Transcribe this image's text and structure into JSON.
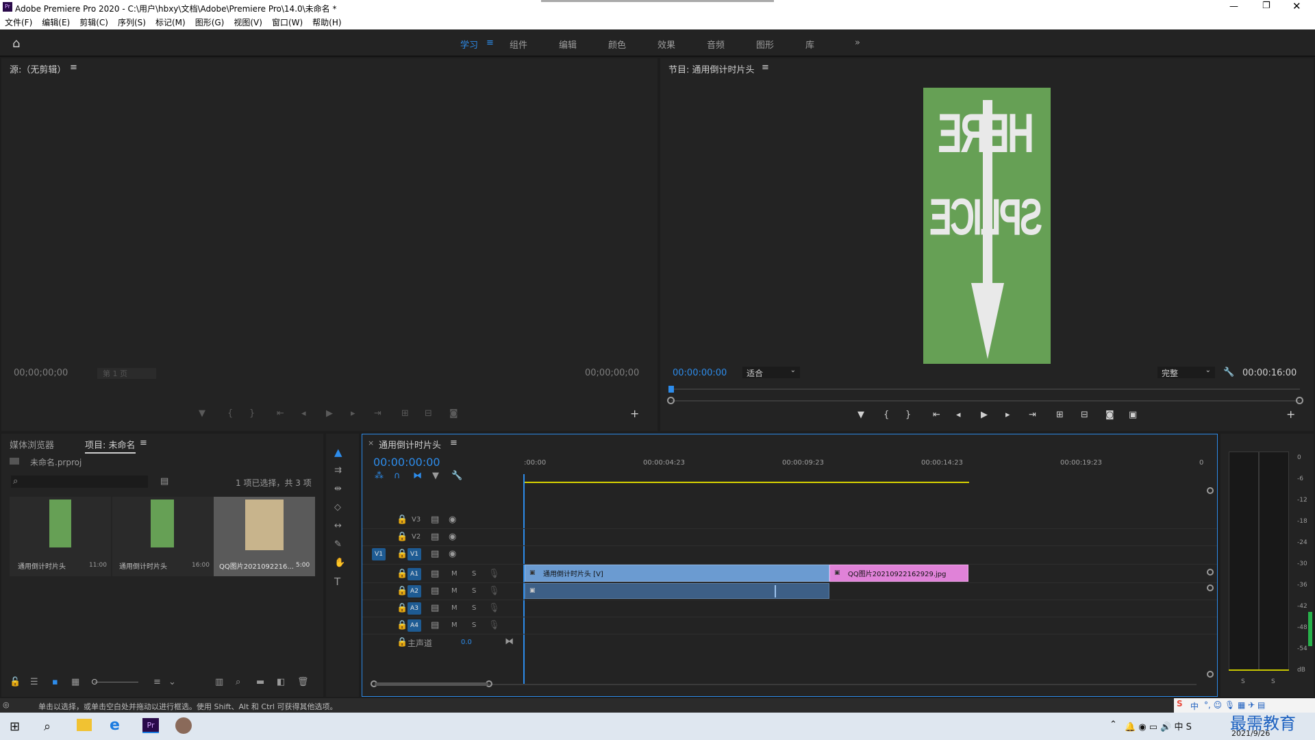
{
  "app": {
    "title": "Adobe Premiere Pro 2020 - C:\\用户\\hbxy\\文档\\Adobe\\Premiere Pro\\14.0\\未命名 *",
    "icon": "Pr"
  },
  "menu": [
    "文件(F)",
    "编辑(E)",
    "剪辑(C)",
    "序列(S)",
    "标记(M)",
    "图形(G)",
    "视图(V)",
    "窗口(W)",
    "帮助(H)"
  ],
  "workspaces": {
    "items": [
      "学习",
      "组件",
      "编辑",
      "颜色",
      "效果",
      "音频",
      "图形",
      "库"
    ],
    "active": "学习"
  },
  "source": {
    "title": "源:（无剪辑）",
    "tc_left": "00;00;00;00",
    "tc_right": "00;00;00;00",
    "page": "第 1 页"
  },
  "program": {
    "title": "节目: 通用倒计时片头",
    "tc_current": "00:00:00:00",
    "fit": "适合",
    "quality": "完整",
    "duration": "00:00:16:00",
    "preview_text_1": "HERE",
    "preview_text_2": "SPLICE",
    "preview_bg": "#66a055"
  },
  "project": {
    "tab_media": "媒体浏览器",
    "tab_project": "项目: 未命名",
    "file": "未命名.prproj",
    "selection": "1 项已选择，共 3 项",
    "items": [
      {
        "name": "通用倒计时片头",
        "dur": "11:00"
      },
      {
        "name": "通用倒计时片头",
        "dur": "16:00"
      },
      {
        "name": "QQ图片2021092216...",
        "dur": "5:00"
      }
    ]
  },
  "timeline": {
    "tab": "通用倒计时片头",
    "tc": "00:00:00:00",
    "ticks": [
      ":00:00",
      "00:00:04:23",
      "00:00:09:23",
      "00:00:14:23",
      "00:00:19:23",
      "0"
    ],
    "video_tracks": [
      "V3",
      "V2",
      "V1"
    ],
    "audio_tracks": [
      "A1",
      "A2",
      "A3",
      "A4"
    ],
    "source_target": "V1",
    "master": {
      "label": "主声道",
      "value": "0.0"
    },
    "clips": [
      {
        "label": "通用倒计时片头 [V]",
        "color": "#6b9bd1"
      },
      {
        "label": "QQ图片20210922162929.jpg",
        "color": "#e082d8"
      }
    ],
    "m": "M",
    "s": "S"
  },
  "meter": {
    "labels": [
      "0",
      "-6",
      "-12",
      "-18",
      "-24",
      "-30",
      "-36",
      "-42",
      "-48",
      "-54",
      "dB"
    ],
    "s1": "S",
    "s2": "S"
  },
  "status": "单击以选择，或单击空白处并拖动以进行框选。使用 Shift、Alt 和 Ctrl 可获得其他选项。",
  "taskbar": {
    "date": "2021/9/26",
    "ime": "中",
    "watermark": "最需教育"
  }
}
